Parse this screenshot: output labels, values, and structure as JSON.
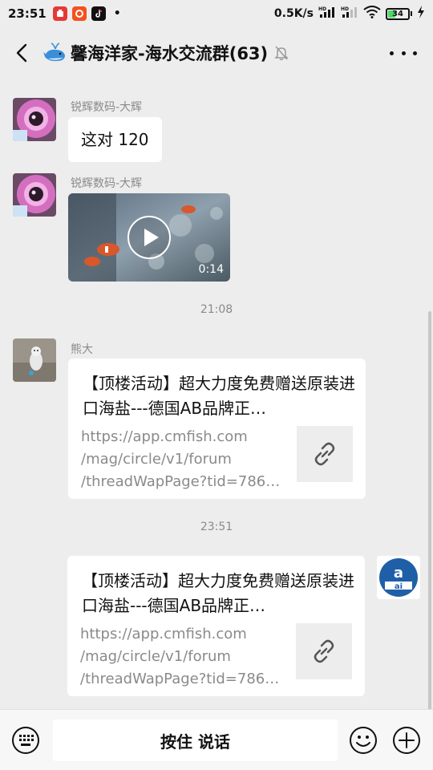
{
  "status_bar": {
    "time": "23:51",
    "dot": "•",
    "net_speed": "0.5K/s",
    "battery_level": "34",
    "battery_fraction": 0.34,
    "app_icons": [
      "red-app-icon",
      "orange-app-icon",
      "tiktok-icon"
    ],
    "indicators": [
      "hd-signal-icon",
      "hd-signal-icon",
      "wifi-icon",
      "battery-icon",
      "charging-icon"
    ]
  },
  "header": {
    "title": "馨海洋家-海水交流群(63)",
    "icons": [
      "whale-icon",
      "mute-bell-icon"
    ]
  },
  "messages": {
    "m1_sender": "锐辉数码-大辉",
    "m1_text": "这对 120",
    "m2_sender": "锐辉数码-大辉",
    "m2_duration": "0:14",
    "time1": "21:08",
    "m3_sender": "熊大",
    "m3_title": "【顶楼活动】超大力度免费赠送原装进口海盐---德国AB品牌正…",
    "m3_url": "https://app.cmfish.com\n/mag/circle/v1/forum\n/threadWapPage?tid=786…",
    "time2": "23:51",
    "m4_title": "【顶楼活动】超大力度免费赠送原装进口海盐---德国AB品牌正…",
    "m4_url": "https://app.cmfish.com\n/mag/circle/v1/forum\n/threadWapPage?tid=786…"
  },
  "input_bar": {
    "voice_label": "按住 说话",
    "icons": [
      "keyboard-icon",
      "emoji-icon",
      "plus-icon"
    ]
  },
  "colors": {
    "background": "#ededed",
    "bubble": "#ffffff",
    "meta_text": "#8a8a8a",
    "battery_green": "#4cd964"
  }
}
